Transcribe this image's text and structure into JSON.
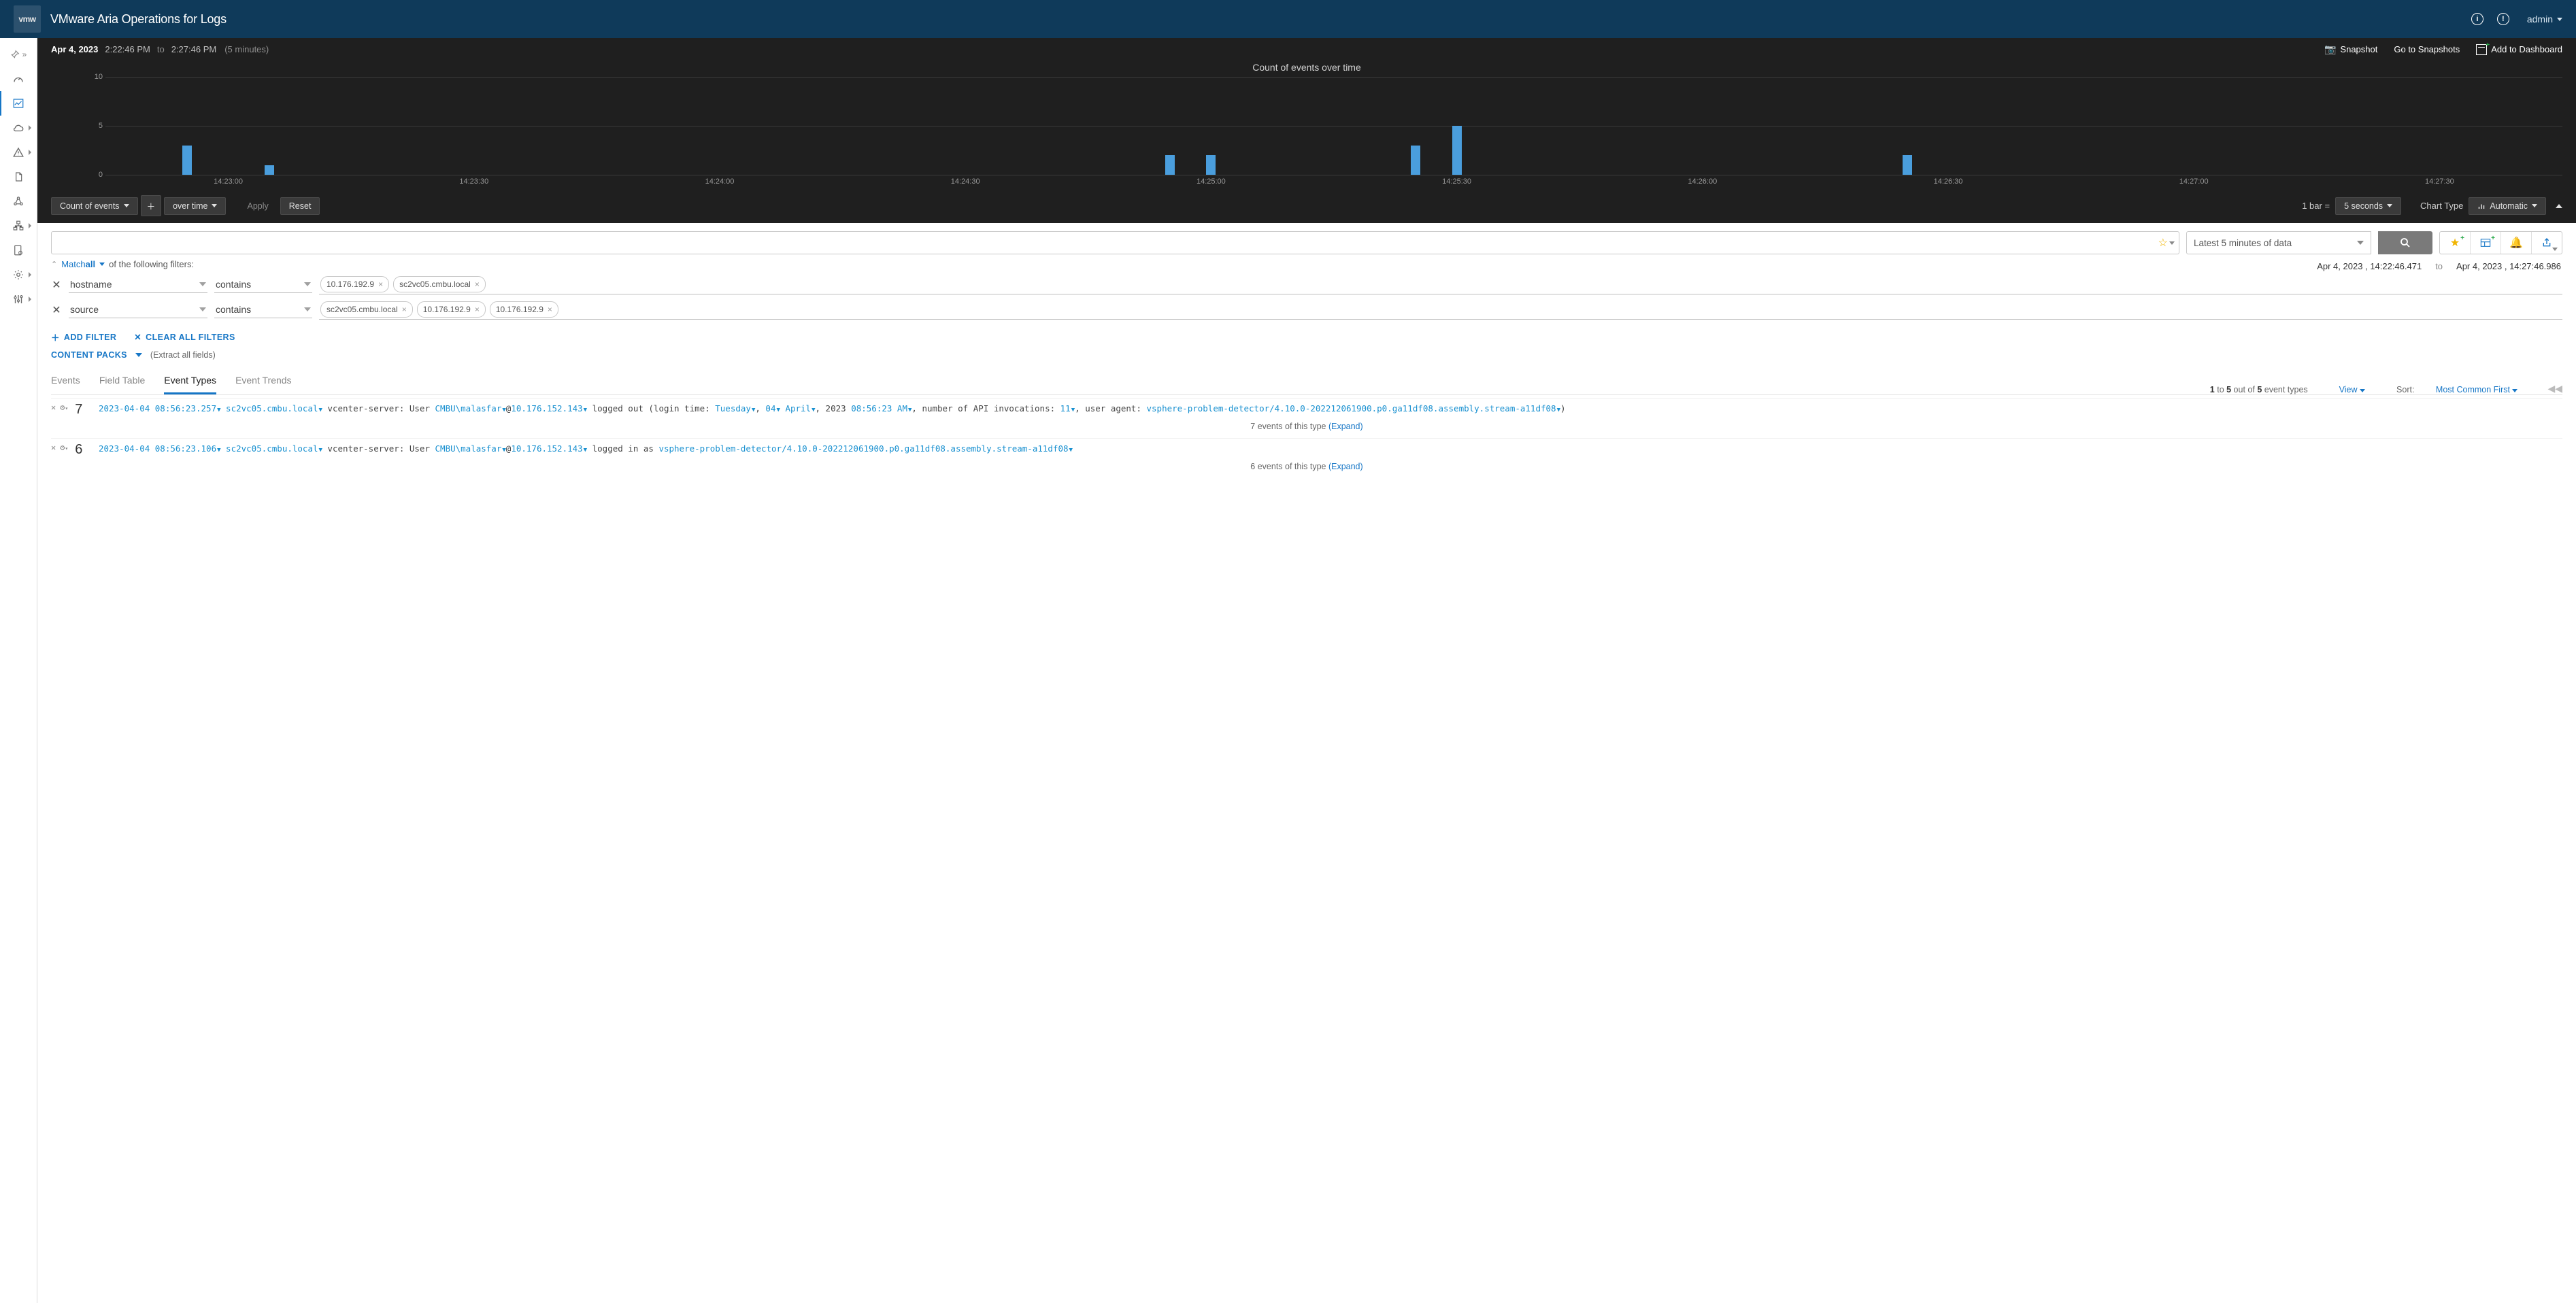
{
  "header": {
    "logo_text": "vmw",
    "app_title": "VMware Aria Operations for Logs",
    "user_label": "admin"
  },
  "time_range": {
    "date_label": "Apr 4, 2023",
    "start_time": "2:22:46 PM",
    "to_label": "to",
    "end_time": "2:27:46 PM",
    "duration_label": "(5 minutes)",
    "snapshot_label": "Snapshot",
    "go_to_snapshots_label": "Go to Snapshots",
    "add_to_dashboard_label": "Add to Dashboard"
  },
  "chart": {
    "title": "Count of events over time",
    "count_of_events_label": "Count of events",
    "over_time_label": "over time",
    "apply_label": "Apply",
    "reset_label": "Reset",
    "one_bar_label": "1 bar =",
    "bar_interval_label": "5 seconds",
    "chart_type_label": "Chart Type",
    "chart_type_value": "Automatic"
  },
  "chart_data": {
    "type": "bar",
    "title": "Count of events over time",
    "ylabel": "",
    "xlabel": "",
    "ylim": [
      0,
      10
    ],
    "y_ticks": [
      0,
      5,
      10
    ],
    "x_ticks": [
      "14:23:00",
      "14:23:30",
      "14:24:00",
      "14:24:30",
      "14:25:00",
      "14:25:30",
      "14:26:00",
      "14:26:30",
      "14:27:00",
      "14:27:30"
    ],
    "points": [
      {
        "t": "14:22:55",
        "v": 3
      },
      {
        "t": "14:23:05",
        "v": 1
      },
      {
        "t": "14:24:55",
        "v": 2
      },
      {
        "t": "14:25:00",
        "v": 2
      },
      {
        "t": "14:25:25",
        "v": 3
      },
      {
        "t": "14:25:30",
        "v": 5
      },
      {
        "t": "14:26:25",
        "v": 2
      }
    ]
  },
  "query": {
    "placeholder": "",
    "time_picker_label": "Latest 5 minutes of data",
    "real_start": "Apr 4, 2023 ,  14:22:46.471",
    "real_to": "to",
    "real_end": "Apr 4, 2023 ,  14:27:46.986",
    "match_prefix": "Match",
    "match_mode": "all",
    "match_suffix": "of the following filters:"
  },
  "filters": [
    {
      "field": "hostname",
      "operator": "contains",
      "values": [
        "10.176.192.9",
        "sc2vc05.cmbu.local"
      ]
    },
    {
      "field": "source",
      "operator": "contains",
      "values": [
        "sc2vc05.cmbu.local",
        "10.176.192.9",
        "10.176.192.9"
      ]
    }
  ],
  "filter_actions": {
    "add_filter_label": "ADD FILTER",
    "clear_label": "CLEAR ALL FILTERS",
    "content_packs_label": "CONTENT PACKS",
    "extract_hint": "(Extract all fields)"
  },
  "tabs": {
    "items": [
      "Events",
      "Field Table",
      "Event Types",
      "Event Trends"
    ],
    "active_index": 2,
    "result_meta_prefix": "1",
    "result_meta_to": " to ",
    "result_meta_upper": "5",
    "result_meta_outof": " out of ",
    "result_meta_total": "5",
    "result_meta_suffix": " event types",
    "view_label": "View",
    "sort_label": "Sort:",
    "sort_value": "Most Common First"
  },
  "events": [
    {
      "count": "7",
      "summary_suffix": "7 events of this type",
      "expand_label": "(Expand)",
      "segments": [
        {
          "t": "2023-04-04 08:56:23.257",
          "k": "tk"
        },
        {
          "t": "  ",
          "k": "p"
        },
        {
          "t": "sc2vc05.cmbu.local",
          "k": "tk"
        },
        {
          "t": " vcenter-server: User ",
          "k": "p"
        },
        {
          "t": "CMBU\\malasfar",
          "k": "tk"
        },
        {
          "t": "@",
          "k": "p"
        },
        {
          "t": "10.176.152.143",
          "k": "tk"
        },
        {
          "t": " logged out (login time: ",
          "k": "p"
        },
        {
          "t": "Tuesday",
          "k": "tk"
        },
        {
          "t": ", ",
          "k": "p"
        },
        {
          "t": "04",
          "k": "tk"
        },
        {
          "t": " ",
          "k": "p"
        },
        {
          "t": "April",
          "k": "tk"
        },
        {
          "t": ", 2023 ",
          "k": "p"
        },
        {
          "t": "08:56:23 AM",
          "k": "tk"
        },
        {
          "t": ", number of API invocations: ",
          "k": "p"
        },
        {
          "t": "11",
          "k": "tk"
        },
        {
          "t": ", user agent: ",
          "k": "p"
        },
        {
          "t": "vsphere-problem-detector/4.10.0-202212061900.p0.ga11df08.assembly.stream-a11df08",
          "k": "tk"
        },
        {
          "t": ")",
          "k": "p"
        }
      ]
    },
    {
      "count": "6",
      "summary_suffix": "6 events of this type",
      "expand_label": "(Expand)",
      "segments": [
        {
          "t": "2023-04-04 08:56:23.106",
          "k": "tk"
        },
        {
          "t": "  ",
          "k": "p"
        },
        {
          "t": "sc2vc05.cmbu.local",
          "k": "tk"
        },
        {
          "t": " vcenter-server: User ",
          "k": "p"
        },
        {
          "t": "CMBU\\malasfar",
          "k": "tk"
        },
        {
          "t": "@",
          "k": "p"
        },
        {
          "t": "10.176.152.143",
          "k": "tk"
        },
        {
          "t": " logged in as ",
          "k": "p"
        },
        {
          "t": "vsphere-problem-detector/4.10.0-202212061900.p0.ga11df08.assembly.stream-a11df08",
          "k": "tk"
        }
      ]
    }
  ]
}
